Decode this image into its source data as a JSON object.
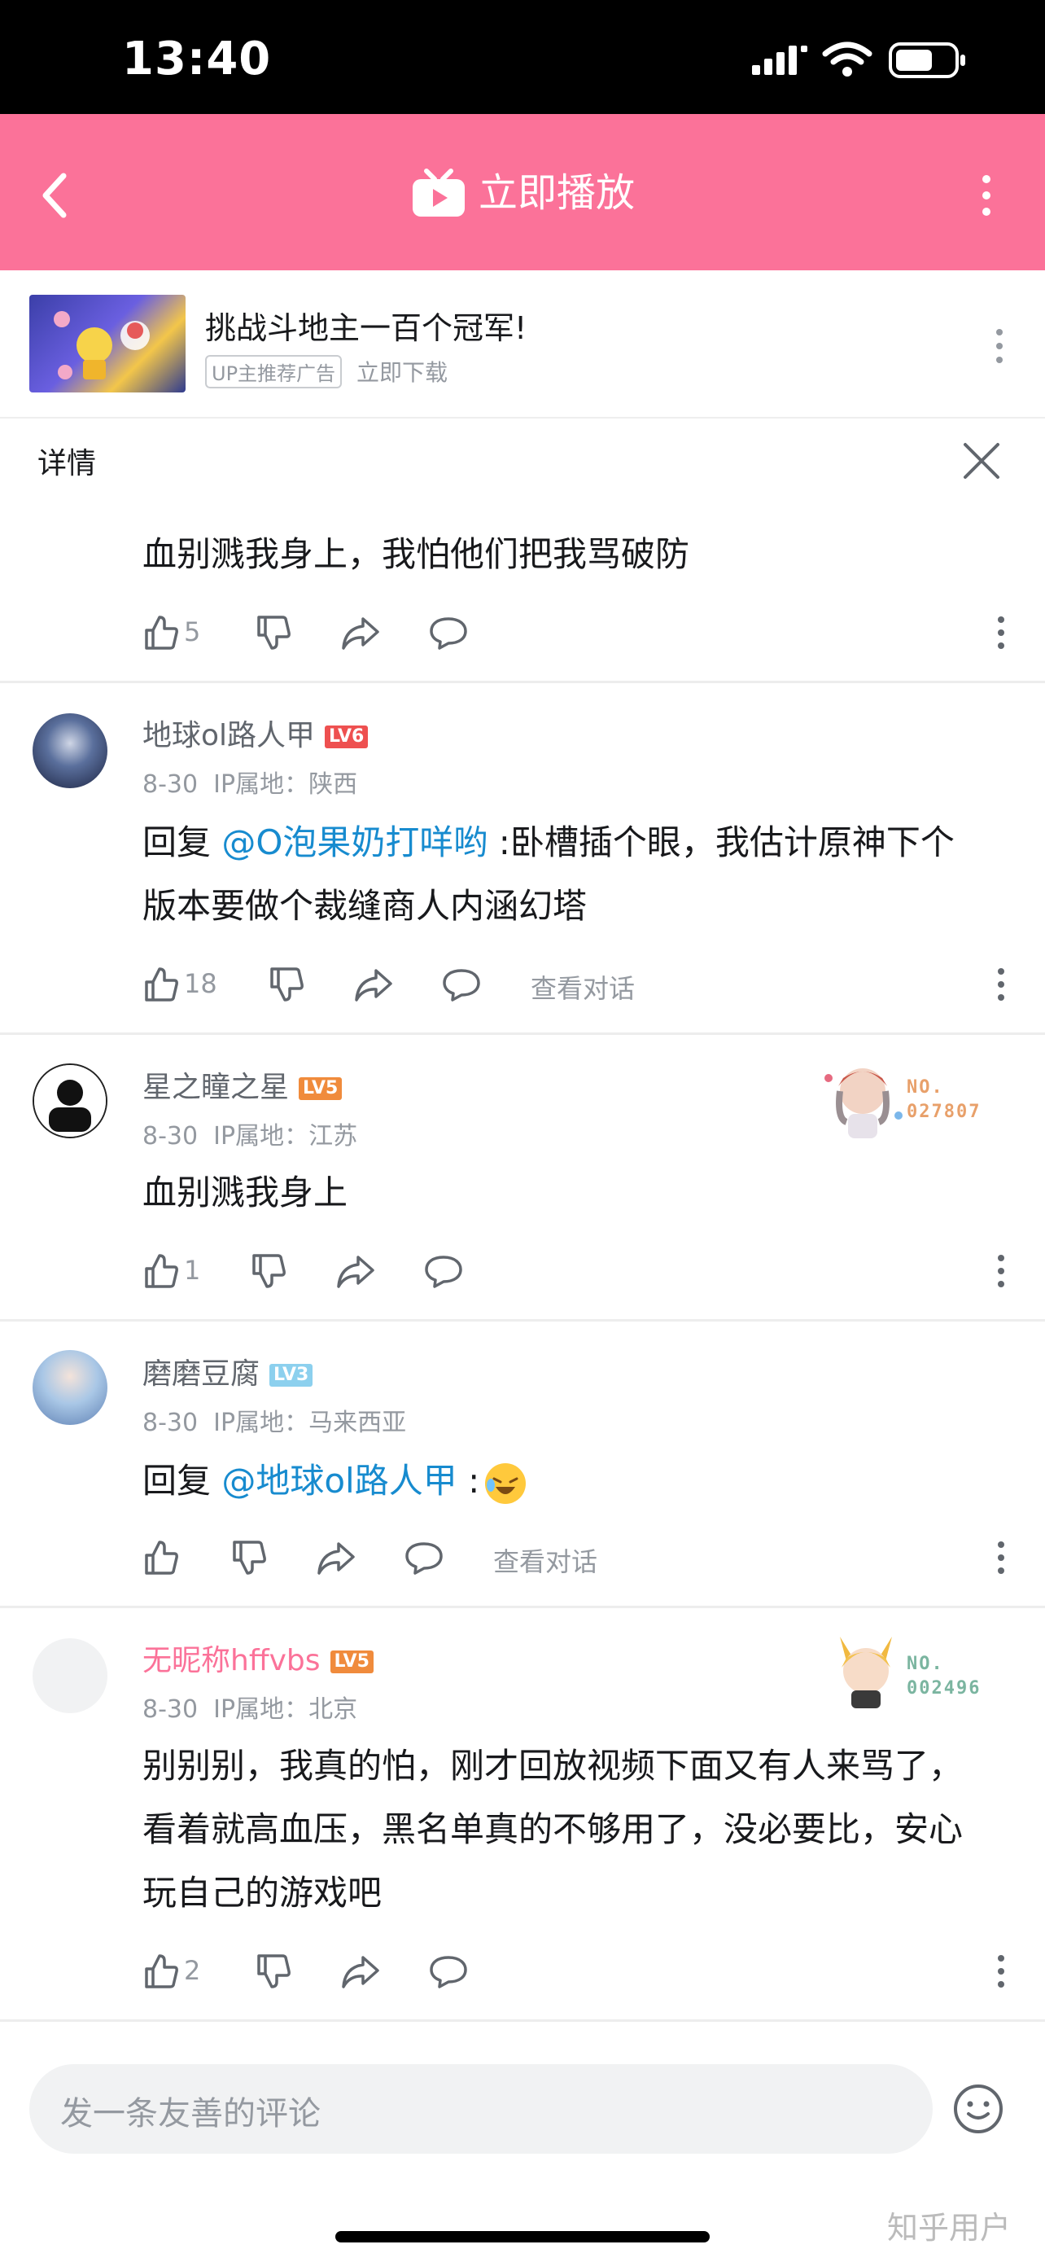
{
  "status": {
    "time": "13:40"
  },
  "header": {
    "title": "立即播放",
    "back_icon": "chevron-left-icon",
    "more_icon": "more-vertical-icon",
    "bg": "#fb7299"
  },
  "ad": {
    "title": "挑战斗地主一百个冠军!",
    "tag": "UP主推荐广告",
    "download": "立即下载"
  },
  "details": {
    "label": "详情"
  },
  "comments": [
    {
      "text": "血别溅我身上，我怕他们把我骂破防",
      "likes": "5"
    },
    {
      "user": "地球ol路人甲",
      "level": "LV6",
      "date": "8-30",
      "ip": "IP属地：陕西",
      "reply_prefix": "回复 ",
      "reply_to": "@O泡果奶打咩哟",
      "text": " :卧槽插个眼，我估计原神下个版本要做个裁缝商人内涵幻塔",
      "likes": "18",
      "view_conv": "查看对话"
    },
    {
      "user": "星之瞳之星",
      "level": "LV5",
      "date": "8-30",
      "ip": "IP属地：江苏",
      "text": "血别溅我身上",
      "likes": "1",
      "badge_no": "NO.",
      "badge_num": "027807"
    },
    {
      "user": "磨磨豆腐",
      "level": "LV3",
      "date": "8-30",
      "ip": "IP属地：马来西亚",
      "reply_prefix": "回复 ",
      "reply_to": "@地球ol路人甲",
      "text": " :",
      "likes": "",
      "view_conv": "查看对话"
    },
    {
      "user": "无昵称hffvbs",
      "level": "LV5",
      "date": "8-30",
      "ip": "IP属地：北京",
      "text": "别别别，我真的怕，刚才回放视频下面又有人来骂了，看着就高血压，黑名单真的不够用了，没必要比，安心玩自己的游戏吧",
      "likes": "2",
      "badge_no": "NO.",
      "badge_num": "002496"
    }
  ],
  "input": {
    "placeholder": "发一条友善的评论"
  },
  "watermark": "知乎用户"
}
